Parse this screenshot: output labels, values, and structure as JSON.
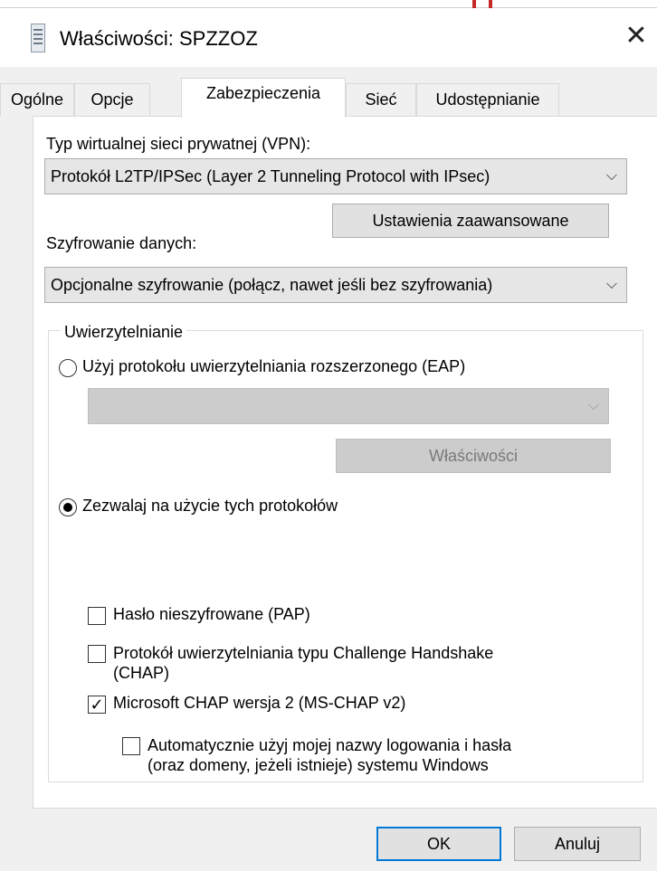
{
  "window": {
    "title": "Właściwości: SPZZOZ",
    "close_glyph": "✕"
  },
  "tabs": [
    {
      "label": "Ogólne",
      "active": false
    },
    {
      "label": "Opcje",
      "active": false
    },
    {
      "label": "Zabezpieczenia",
      "active": true
    },
    {
      "label": "Sieć",
      "active": false
    },
    {
      "label": "Udostępnianie",
      "active": false
    }
  ],
  "vpn": {
    "label": "Typ wirtualnej sieci prywatnej (VPN):",
    "selected": "Protokół L2TP/IPSec (Layer 2 Tunneling Protocol with IPsec)",
    "advanced_button": "Ustawienia zaawansowane"
  },
  "encryption": {
    "label": "Szyfrowanie danych:",
    "selected": "Opcjonalne szyfrowanie (połącz, nawet jeśli bez szyfrowania)"
  },
  "auth": {
    "group_label": "Uwierzytelnianie",
    "eap_radio": {
      "label": "Użyj protokołu uwierzytelniania rozszerzonego (EAP)",
      "checked": false
    },
    "eap_combo": {
      "selected": "",
      "enabled": false
    },
    "eap_properties_button": "Właściwości",
    "allow_radio": {
      "label": "Zezwalaj na użycie tych protokołów",
      "checked": true
    },
    "protocols": {
      "pap": {
        "label": "Hasło nieszyfrowane (PAP)",
        "checked": false
      },
      "chap": {
        "label_line1": "Protokół uwierzytelniania typu Challenge Handshake",
        "label_line2": "(CHAP)",
        "checked": false
      },
      "mschapv2": {
        "label": "Microsoft CHAP wersja 2 (MS-CHAP v2)",
        "checked": true
      },
      "auto_login": {
        "label_line1": "Automatycznie użyj mojej nazwy logowania i hasła",
        "label_line2": "(oraz domeny, jeżeli istnieje) systemu Windows",
        "checked": false
      }
    }
  },
  "footer": {
    "ok": "OK",
    "cancel": "Anuluj"
  },
  "glyphs": {
    "chevron": "⌵",
    "check": "✓"
  },
  "colors": {
    "focus_border": "#0078d7",
    "panel_bg": "#ffffff",
    "window_bg": "#f0f0f0"
  }
}
